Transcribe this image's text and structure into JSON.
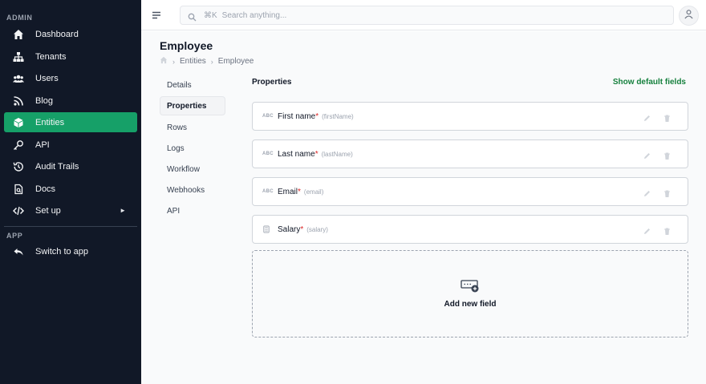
{
  "sidebar": {
    "admin_label": "ADMIN",
    "app_label": "APP",
    "items": [
      {
        "label": "Dashboard",
        "icon": "home-icon"
      },
      {
        "label": "Tenants",
        "icon": "sitemap-icon"
      },
      {
        "label": "Users",
        "icon": "users-icon"
      },
      {
        "label": "Blog",
        "icon": "rss-icon"
      },
      {
        "label": "Entities",
        "icon": "cube-icon"
      },
      {
        "label": "API",
        "icon": "key-icon"
      },
      {
        "label": "Audit Trails",
        "icon": "history-icon"
      },
      {
        "label": "Docs",
        "icon": "document-icon"
      },
      {
        "label": "Set up",
        "icon": "code-icon"
      }
    ],
    "active": "Entities",
    "arrow": "►",
    "app_items": [
      {
        "label": "Switch to app",
        "icon": "reply-icon"
      }
    ]
  },
  "search": {
    "shortcut": "⌘K",
    "placeholder": "Search anything..."
  },
  "page": {
    "title": "Employee",
    "breadcrumb": [
      "Entities",
      "Employee"
    ],
    "breadcrumb_sep": "›"
  },
  "tabs": [
    "Details",
    "Properties",
    "Rows",
    "Logs",
    "Workflow",
    "Webhooks",
    "API"
  ],
  "active_tab": "Properties",
  "properties": {
    "title": "Properties",
    "show_default": "Show default fields",
    "fields": [
      {
        "type": "ABC",
        "title": "First name",
        "required": "*",
        "name": "(firstName)"
      },
      {
        "type": "ABC",
        "title": "Last name",
        "required": "*",
        "name": "(lastName)"
      },
      {
        "type": "ABC",
        "title": "Email",
        "required": "*",
        "name": "(email)"
      },
      {
        "type": "number-icon",
        "title": "Salary",
        "required": "*",
        "name": "(salary)"
      }
    ],
    "add_label": "Add new field"
  },
  "colors": {
    "sidebar_bg": "#111827",
    "active_green": "#16a068",
    "link_green": "#15803d",
    "required_red": "#dc2626"
  }
}
